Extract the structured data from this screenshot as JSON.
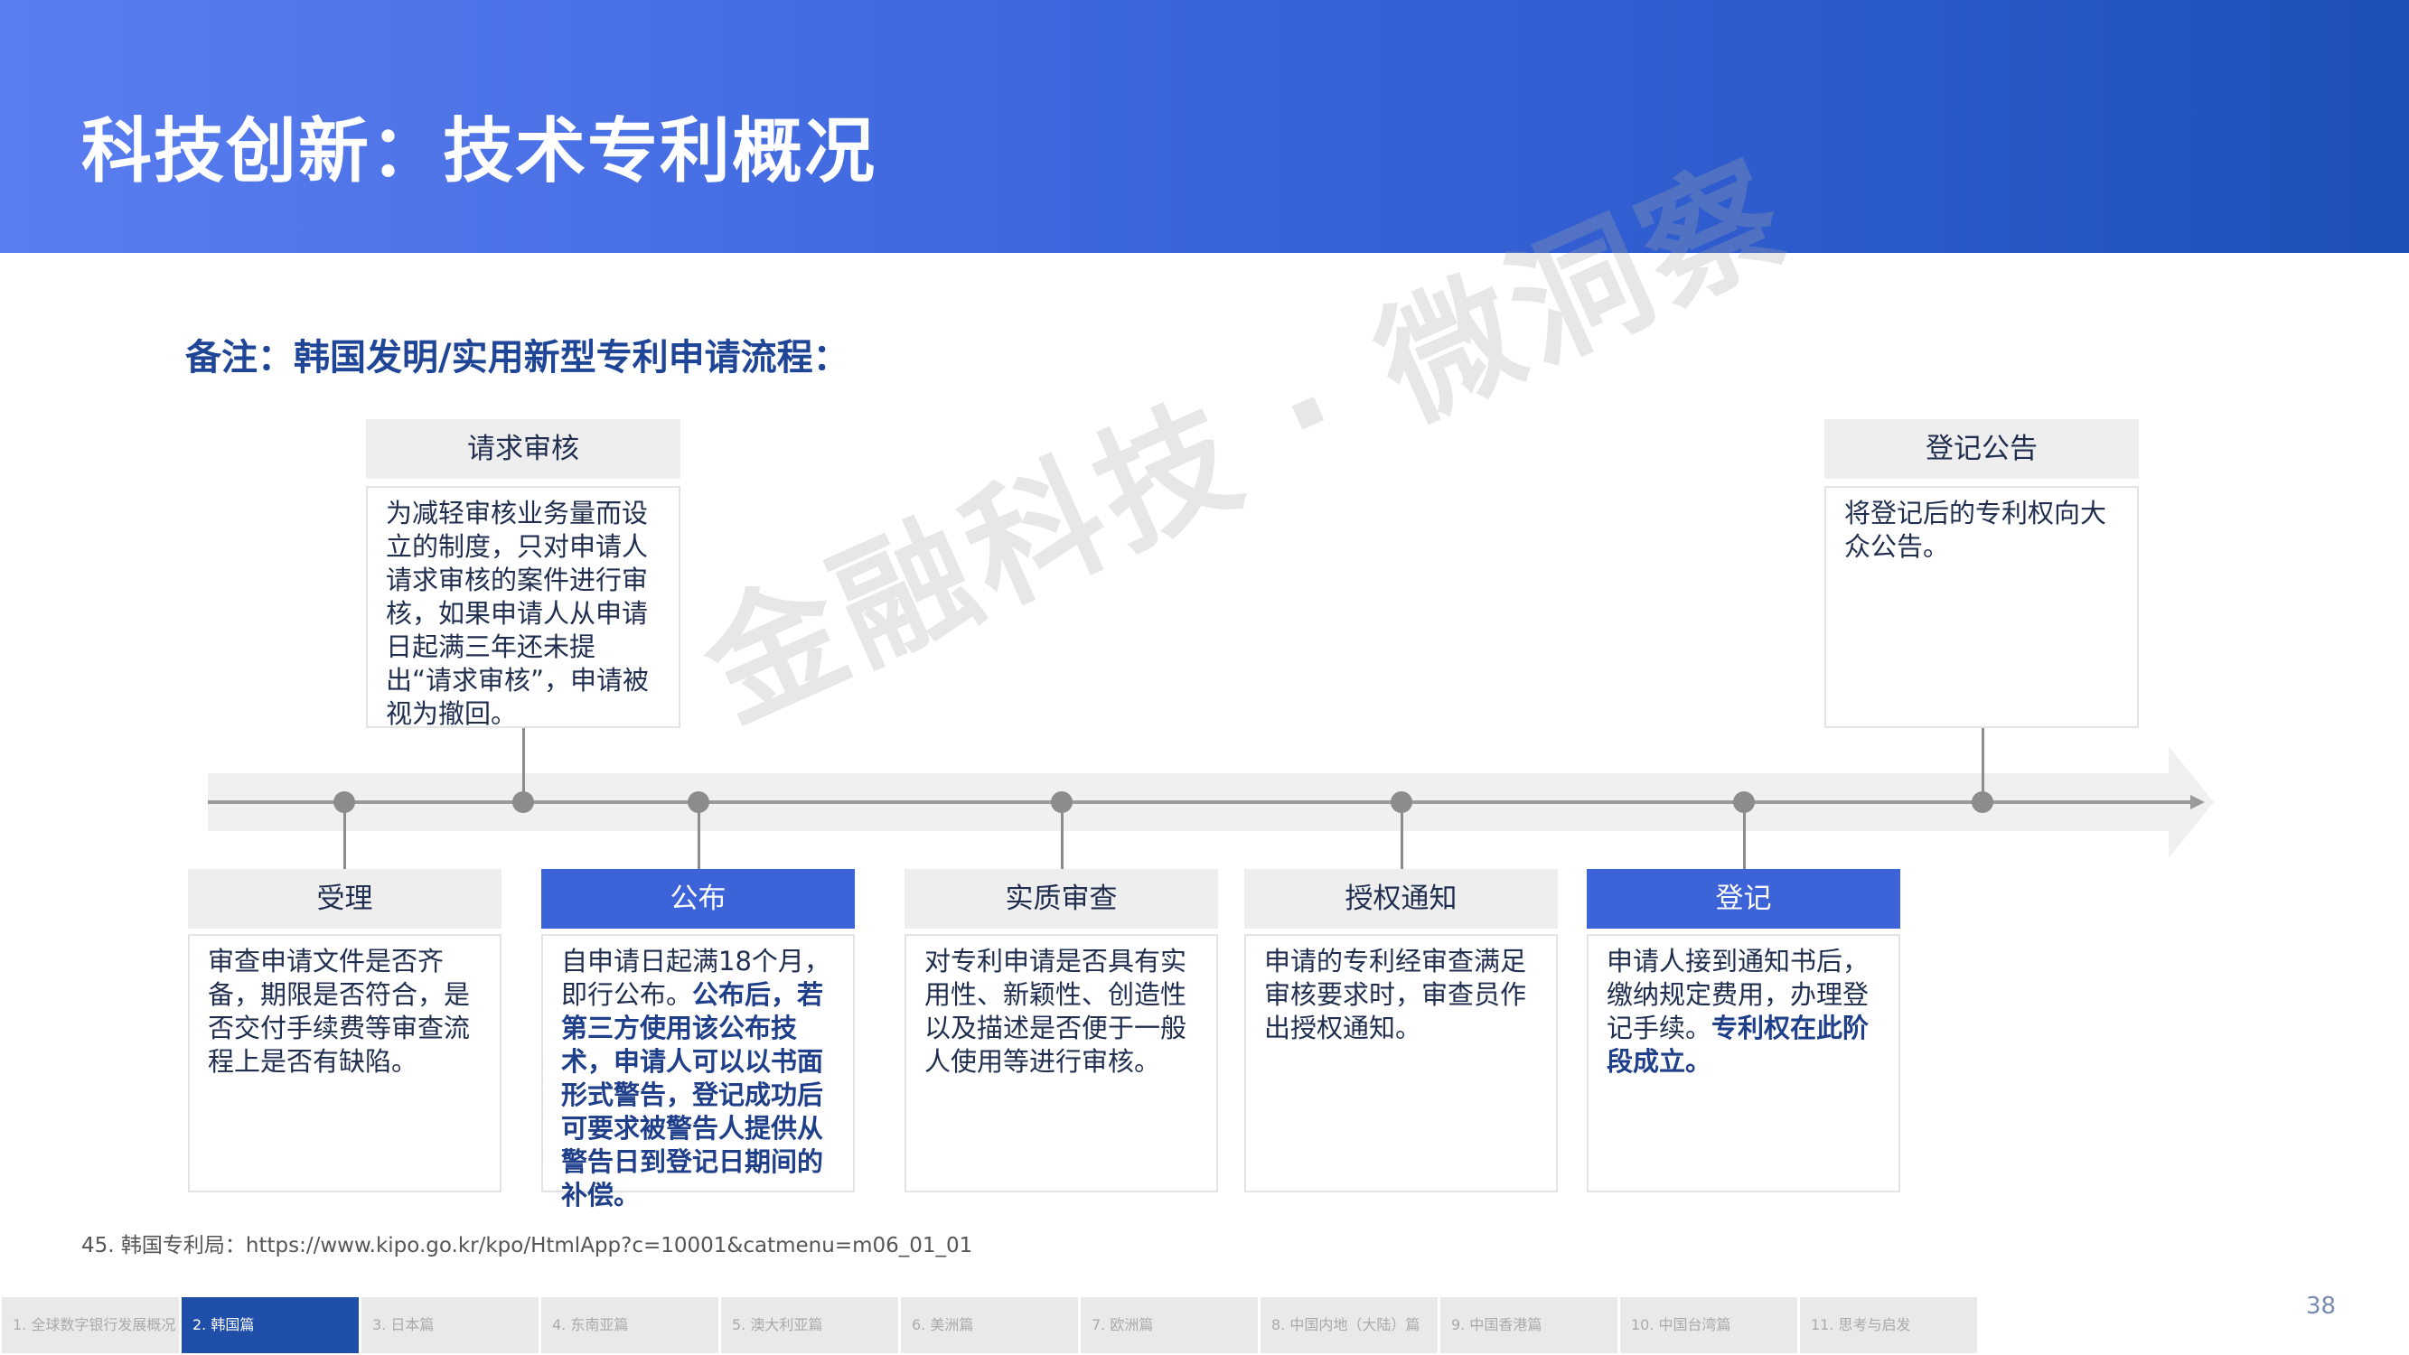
{
  "header": {
    "title": "科技创新：技术专利概况"
  },
  "subtitle": "备注：韩国发明/实用新型专利申请流程：",
  "watermark": "金融科技 · 微洞察",
  "top_steps": [
    {
      "title": "请求审核",
      "body": "为减轻审核业务量而设立的制度，只对申请人请求审核的案件进行审核，如果申请人从申请日起满三年还未提出“请求审核”，申请被视为撤回。"
    },
    {
      "title": "登记公告",
      "body": "将登记后的专利权向大众公告。"
    }
  ],
  "bottom_steps": [
    {
      "title": "受理",
      "body": "审查申请文件是否齐备，期限是否符合，是否交付手续费等审查流程上是否有缺陷。"
    },
    {
      "title": "公布",
      "body_plain": "自申请日起满18个月，即行公布。",
      "body_bold": "公布后，若第三方使用该公布技术，申请人可以以书面形式警告，登记成功后可要求被警告人提供从警告日到登记日期间的补偿。"
    },
    {
      "title": "实质审查",
      "body": "对专利申请是否具有实用性、新颖性、创造性以及描述是否便于一般人使用等进行审核。"
    },
    {
      "title": "授权通知",
      "body": "申请的专利经审查满足审核要求时，审查员作出授权通知。"
    },
    {
      "title": "登记",
      "body_plain": "申请人接到通知书后，缴纳规定费用，办理登记手续。",
      "body_bold": "专利权在此阶段成立。"
    }
  ],
  "footnote": "45. 韩国专利局：https://www.kipo.go.kr/kpo/HtmlApp?c=10001&catmenu=m06_01_01",
  "nav": {
    "tabs": [
      "1. 全球数字银行发展概况",
      "2. 韩国篇",
      "3. 日本篇",
      "4. 东南亚篇",
      "5. 澳大利亚篇",
      "6. 美洲篇",
      "7. 欧洲篇",
      "8. 中国内地（大陆）篇",
      "9. 中国香港篇",
      "10. 中国台湾篇",
      "11. 思考与启发"
    ],
    "active_index": 1
  },
  "page_number": "38",
  "colors": {
    "header_start": "#5a7ef0",
    "header_end": "#1e4fb5",
    "active_step": "#3d63d8",
    "accent_text": "#1f4597",
    "nav_active": "#1f4fa8"
  }
}
